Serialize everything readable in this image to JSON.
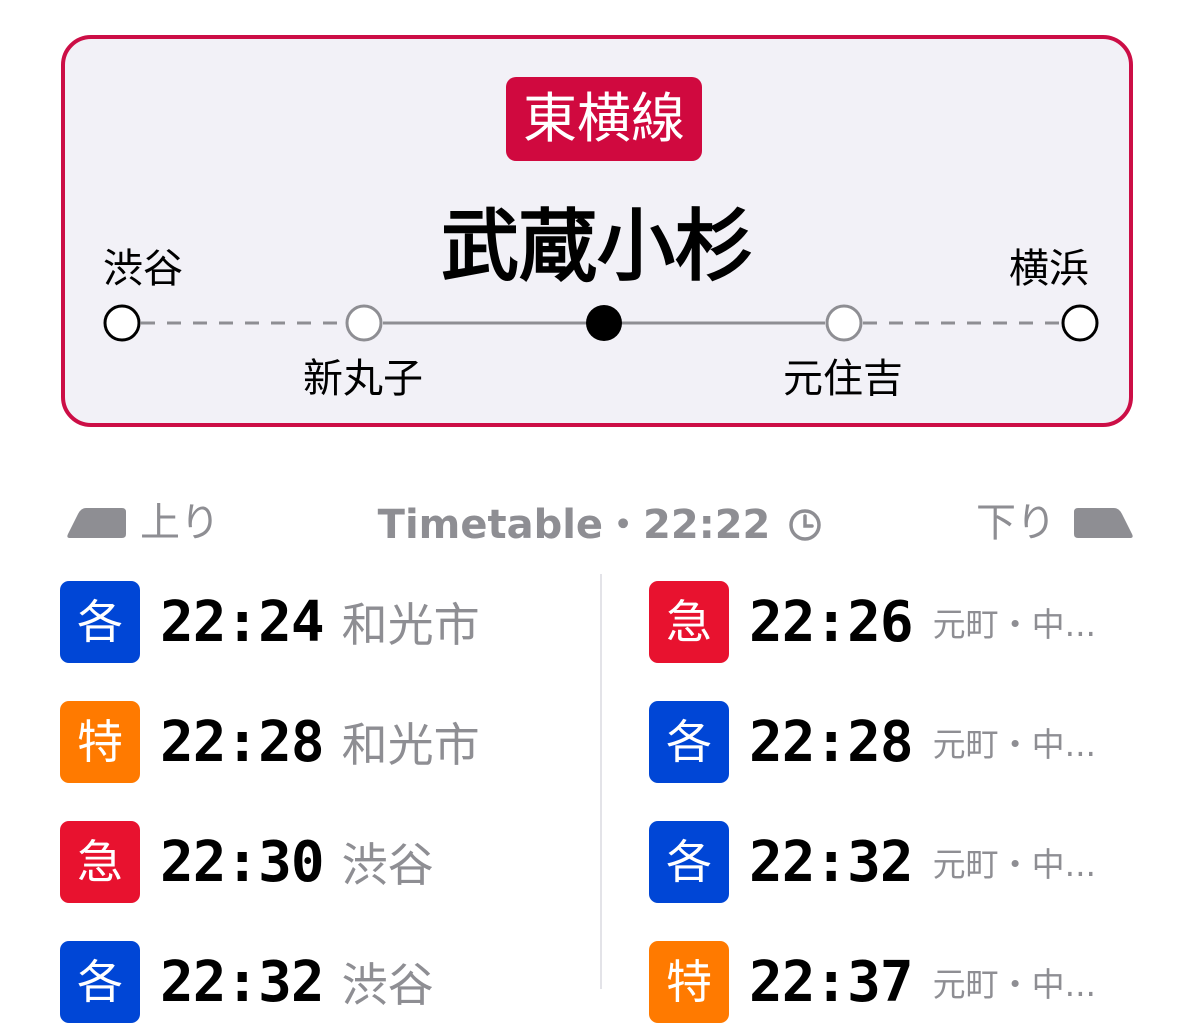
{
  "station": {
    "line_name": "東横線",
    "line_color": "#d0093f",
    "name": "武蔵小杉",
    "terminal_left": "渋谷",
    "terminal_right": "横浜",
    "prev_station": "新丸子",
    "next_station": "元住吉"
  },
  "header": {
    "up_label": "上り",
    "down_label": "下り",
    "title": "Timetable・22:22",
    "up_icon": "train-front-left-icon",
    "down_icon": "train-front-right-icon",
    "clock_icon": "clock-icon"
  },
  "types": {
    "local": {
      "label": "各",
      "color": "#0046d6"
    },
    "limited": {
      "label": "特",
      "color": "#ff7a00"
    },
    "express": {
      "label": "急",
      "color": "#e8122f"
    }
  },
  "up": [
    {
      "type_label": "各",
      "time": "22:24",
      "dest": "和光市"
    },
    {
      "type_label": "特",
      "time": "22:28",
      "dest": "和光市"
    },
    {
      "type_label": "急",
      "time": "22:30",
      "dest": "渋谷"
    },
    {
      "type_label": "各",
      "time": "22:32",
      "dest": "渋谷"
    }
  ],
  "down": [
    {
      "type_label": "急",
      "time": "22:26",
      "dest": "元町・中..."
    },
    {
      "type_label": "各",
      "time": "22:28",
      "dest": "元町・中..."
    },
    {
      "type_label": "各",
      "time": "22:32",
      "dest": "元町・中..."
    },
    {
      "type_label": "特",
      "time": "22:37",
      "dest": "元町・中..."
    }
  ]
}
